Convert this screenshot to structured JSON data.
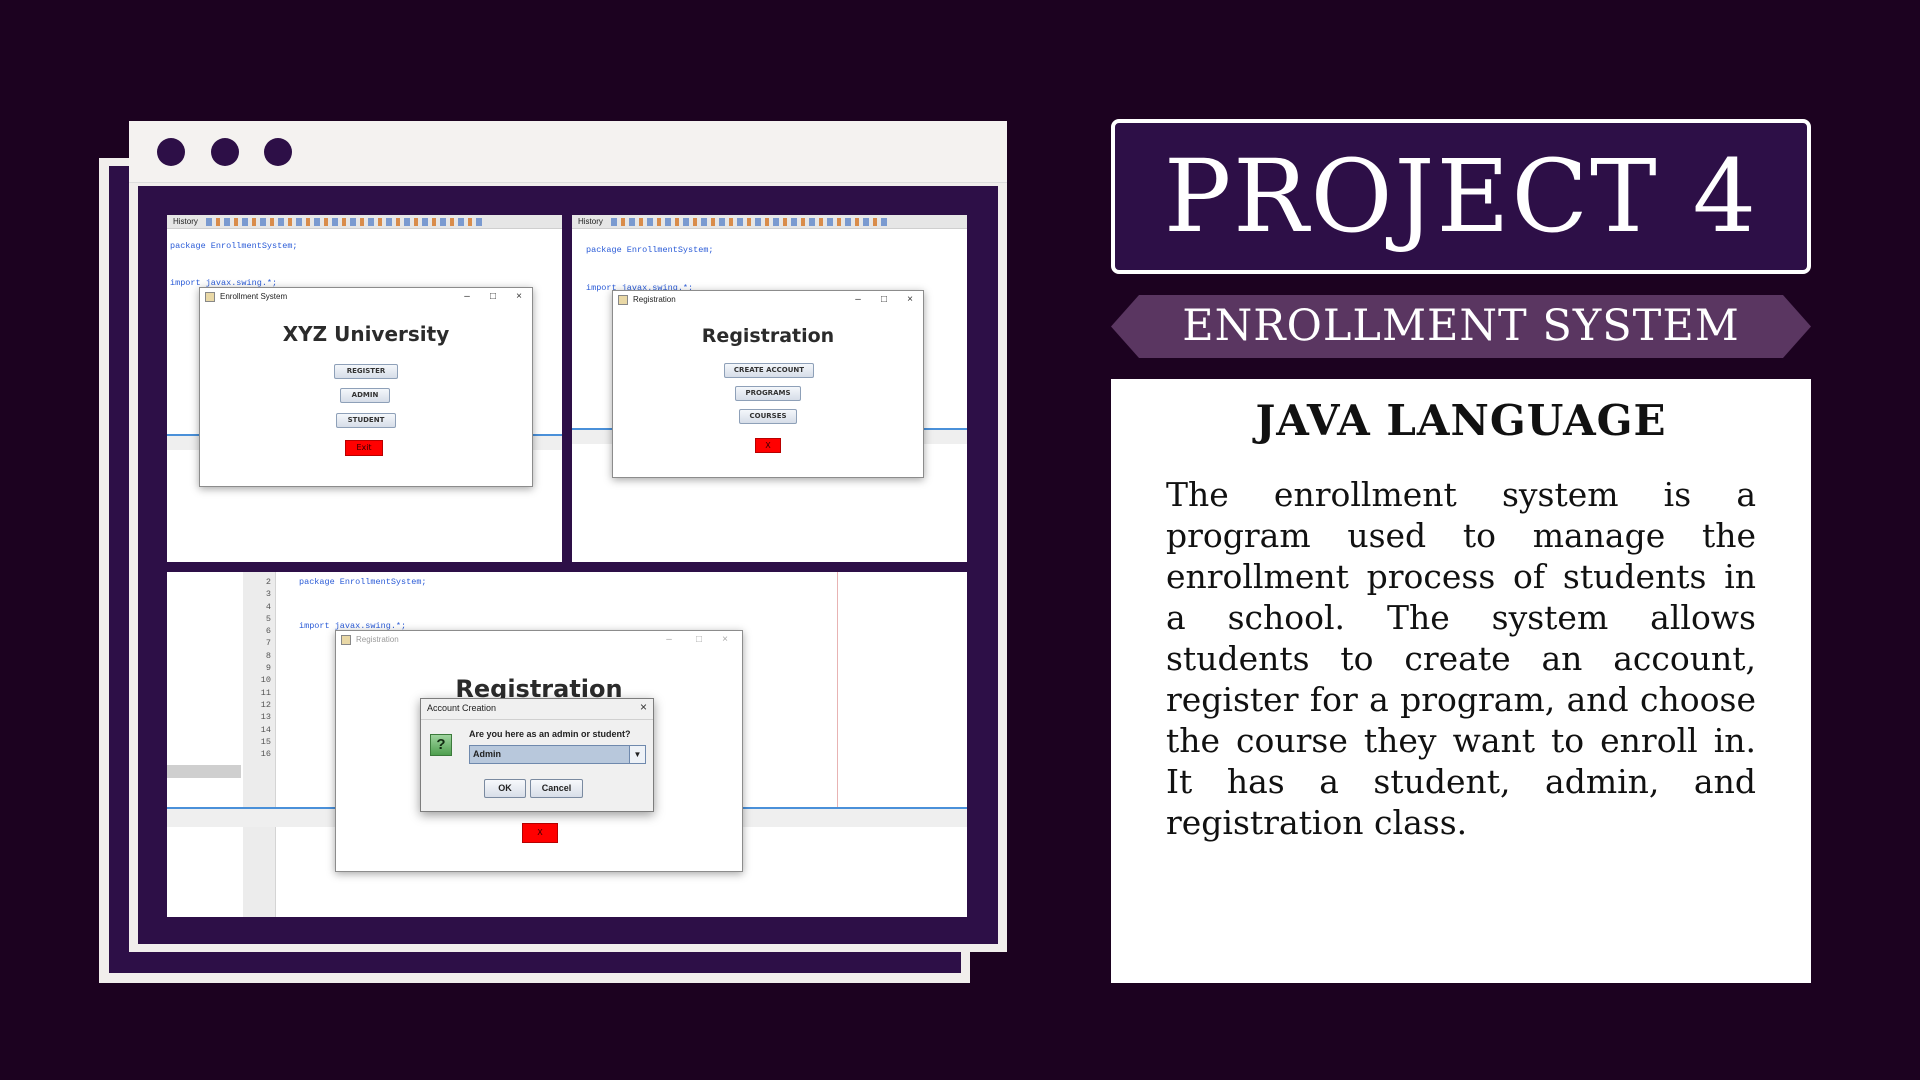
{
  "title": "PROJECT 4",
  "subtitle": "ENROLLMENT SYSTEM",
  "card": {
    "heading": "JAVA LANGUAGE",
    "body": "The enrollment system is a program used to manage the enrollment process of students in a school. The system allows students to create an account, register for a program, and choose the course they want to enroll in. It has a student, admin, and registration class."
  },
  "colors": {
    "background": "#1c0220",
    "accent_purple": "#2d0f47",
    "pill_purple": "#5a3661",
    "exit_button_red": "#ff0000"
  },
  "shot1": {
    "toolbar_label": "History",
    "code_package": "package EnrollmentSystem;",
    "code_import": "import javax.swing.*;",
    "window_title": "Enrollment System",
    "heading": "XYZ University",
    "buttons": [
      "REGISTER",
      "ADMIN",
      "STUDENT"
    ],
    "exit_label": "Exit"
  },
  "shot2": {
    "toolbar_label": "History",
    "code_package": "package EnrollmentSystem;",
    "code_import": "import javax.swing.*;",
    "window_title": "Registration",
    "heading": "Registration",
    "buttons": [
      "CREATE ACCOUNT",
      "PROGRAMS",
      "COURSES"
    ],
    "exit_label": "X"
  },
  "shot3": {
    "line_numbers": "2\n3\n4\n5\n6\n7\n8\n9\n10\n11\n12\n13\n14\n15\n16",
    "code_package": "package EnrollmentSystem;",
    "code_import": "import javax.swing.*;",
    "window_title": "Registration",
    "heading": "Registration",
    "exit_label": "X",
    "dialog": {
      "title": "Account Creation",
      "question_icon": "?",
      "prompt": "Are you here as an admin or student?",
      "selected": "Admin",
      "ok_label": "OK",
      "cancel_label": "Cancel"
    }
  },
  "icons": {
    "close": "×",
    "minimize": "–",
    "maximize": "□",
    "dropdown": "▼"
  }
}
